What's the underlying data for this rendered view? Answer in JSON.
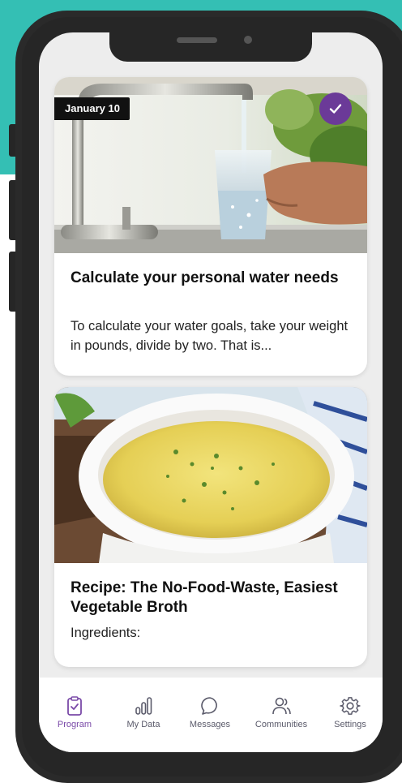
{
  "cards": [
    {
      "date_badge": "January 10",
      "completed": true,
      "image": "water-faucet-glass",
      "title": "Calculate your personal water needs",
      "description": "To calculate your water goals, take your weight in pounds, divide by two.  That is..."
    },
    {
      "image": "vegetable-broth-bowl",
      "title": "Recipe: The No-Food-Waste, Easiest Vegetable Broth",
      "description": "Ingredients:"
    }
  ],
  "tabbar": {
    "items": [
      {
        "label": "Program",
        "icon": "clipboard-check-icon",
        "active": true
      },
      {
        "label": "My Data",
        "icon": "bar-chart-icon",
        "active": false
      },
      {
        "label": "Messages",
        "icon": "chat-bubble-icon",
        "active": false
      },
      {
        "label": "Communities",
        "icon": "people-icon",
        "active": false
      },
      {
        "label": "Settings",
        "icon": "gear-icon",
        "active": false
      }
    ]
  },
  "colors": {
    "background_accent": "#34bfb4",
    "brand_purple": "#6b3a98",
    "tab_active": "#7a4aa8",
    "tab_inactive": "#5a5a6a"
  }
}
